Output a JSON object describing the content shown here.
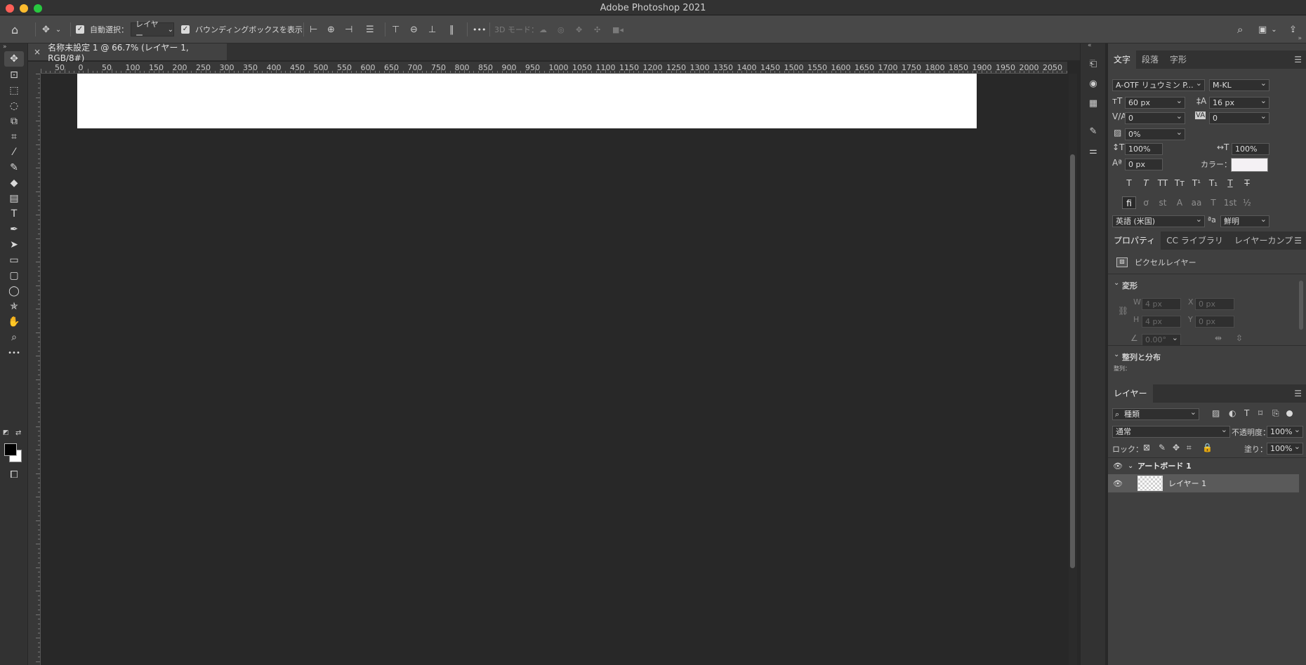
{
  "window": {
    "title": "Adobe Photoshop 2021",
    "traffic_light_colors": [
      "#fe5f57",
      "#febc2e",
      "#28c840"
    ]
  },
  "options_bar": {
    "auto_select_label": "自動選択：",
    "auto_select_value": "レイヤー",
    "show_transform_label": "バウンディングボックスを表示",
    "more_label": "•••",
    "mode_3d_label": "3D モード："
  },
  "document": {
    "tab_title": "名称未設定 1 @ 66.7% (レイヤー 1, RGB/8#)",
    "close_glyph": "×",
    "ruler_labels": [
      "50",
      "0",
      "50",
      "100",
      "150",
      "200",
      "250",
      "300",
      "350",
      "400",
      "450",
      "500",
      "550",
      "600",
      "650",
      "700",
      "750",
      "800",
      "850",
      "900",
      "950",
      "1000",
      "1050",
      "1100",
      "1150",
      "1200",
      "1250",
      "1300",
      "1350",
      "1400",
      "1450",
      "1500",
      "1550",
      "1600",
      "1650",
      "1700",
      "1750",
      "1800",
      "1850",
      "1900",
      "1950",
      "2000",
      "2050"
    ],
    "artboard_color": "#ffffff",
    "canvas_bg": "#282828"
  },
  "toolbar": {
    "tools": [
      {
        "name": "move-tool",
        "glyph": "✥"
      },
      {
        "name": "artboard-tool",
        "glyph": "⊡"
      },
      {
        "name": "marquee-tool",
        "glyph": "⬚"
      },
      {
        "name": "lasso-tool",
        "glyph": "◌"
      },
      {
        "name": "object-select-tool",
        "glyph": "⧉"
      },
      {
        "name": "crop-tool",
        "glyph": "⌗"
      },
      {
        "name": "eyedropper-tool",
        "glyph": "⁄"
      },
      {
        "name": "brush-tool",
        "glyph": "✎"
      },
      {
        "name": "eraser-tool",
        "glyph": "◆"
      },
      {
        "name": "gradient-tool",
        "glyph": "▤"
      },
      {
        "name": "type-tool",
        "glyph": "T"
      },
      {
        "name": "pen-tool",
        "glyph": "✒"
      },
      {
        "name": "path-select-tool",
        "glyph": "➤"
      },
      {
        "name": "rectangle-tool",
        "glyph": "▭"
      },
      {
        "name": "rounded-rect-tool",
        "glyph": "▢"
      },
      {
        "name": "ellipse-tool",
        "glyph": "◯"
      },
      {
        "name": "custom-shape-tool",
        "glyph": "✯"
      },
      {
        "name": "hand-tool",
        "glyph": "✋"
      },
      {
        "name": "zoom-tool",
        "glyph": "⌕"
      },
      {
        "name": "more-tools",
        "glyph": "•••"
      }
    ]
  },
  "character_panel": {
    "tabs": [
      "文字",
      "段落",
      "字形"
    ],
    "font_family": "A-OTF リュウミン P...",
    "font_style": "M-KL",
    "font_size": "60 px",
    "leading": "16 px",
    "kerning": "0",
    "tracking": "0",
    "tsume": "0%",
    "vertical_scale": "100%",
    "horizontal_scale": "100%",
    "baseline_shift": "0 px",
    "color_label": "カラー：",
    "text_color": "#f4f1f4",
    "style_glyphs": [
      "T",
      "T",
      "TT",
      "Tт",
      "T¹",
      "T₁",
      "T",
      "T"
    ],
    "opentype_glyphs": [
      "fi",
      "ơ",
      "st",
      "A",
      "aa",
      "T",
      "1st",
      "½"
    ],
    "language": "英語 (米国)",
    "aa_label": "ªa",
    "antialias": "鮮明"
  },
  "properties_panel": {
    "tabs": [
      "プロパティ",
      "CC ライブラリ",
      "レイヤーカンプ"
    ],
    "layer_type": "ピクセルレイヤー",
    "transform_title": "変形",
    "w_label": "W",
    "w_value": "4 px",
    "x_label": "X",
    "x_value": "0 px",
    "h_label": "H",
    "h_value": "4 px",
    "y_label": "Y",
    "y_value": "0 px",
    "angle": "0.00°",
    "align_title": "整列と分布",
    "align_sub": "整列："
  },
  "layers_panel": {
    "tab": "レイヤー",
    "filter_kind": "種類",
    "blend_mode": "通常",
    "opacity_label": "不透明度：",
    "opacity": "100%",
    "lock_label": "ロック：",
    "fill_label": "塗り：",
    "fill": "100%",
    "layers": [
      {
        "name": "アートボード 1",
        "type": "artboard"
      },
      {
        "name": "レイヤー 1",
        "type": "pixel"
      }
    ]
  }
}
